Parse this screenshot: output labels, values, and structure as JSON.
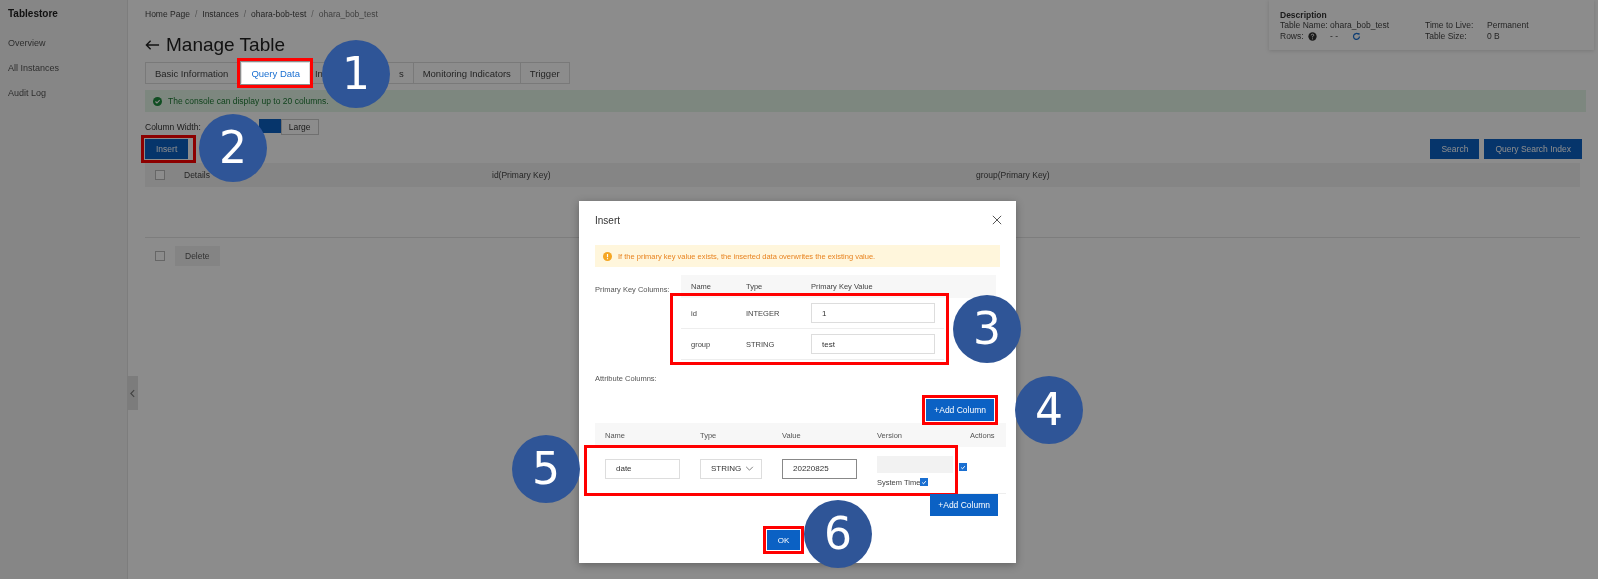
{
  "sidebar": {
    "title": "Tablestore",
    "items": [
      {
        "label": "Overview"
      },
      {
        "label": "All Instances"
      },
      {
        "label": "Audit Log"
      }
    ]
  },
  "breadcrumb": {
    "separator": "/",
    "items": [
      "Home Page",
      "Instances",
      "ohara-bob-test",
      "ohara_bob_test"
    ]
  },
  "page_title": "Manage Table",
  "tabs": [
    {
      "label": "Basic Information",
      "selected": false
    },
    {
      "label": "Query Data",
      "selected": true,
      "highlighted": true
    },
    {
      "label_parts": [
        "In",
        "s"
      ],
      "selected": false
    },
    {
      "label": "Monitoring Indicators",
      "selected": false
    },
    {
      "label": "Trigger",
      "selected": false
    }
  ],
  "notice": {
    "text": "The console can display up to 20 columns."
  },
  "column_width": {
    "label": "Column Width:",
    "options": [
      {
        "selected": true
      },
      {
        "label": "Large",
        "selected": false
      }
    ]
  },
  "toolbar": {
    "insert": {
      "label": "Insert",
      "highlighted": true
    },
    "search": "Search",
    "query_search_index": "Query Search Index"
  },
  "table": {
    "select_all_checked": false,
    "columns": [
      "Details",
      "id(Primary Key)",
      "group(Primary Key)"
    ],
    "footer": {
      "checked": false,
      "delete": {
        "label": "Delete",
        "disabled": true
      }
    }
  },
  "description": {
    "title": "Description",
    "table_name": {
      "label": "Table Name:",
      "value": "ohara_bob_test"
    },
    "rows": {
      "label": "Rows:",
      "value": "- -"
    },
    "ttl": {
      "label": "Time to Live:",
      "value": "Permanent"
    },
    "size": {
      "label": "Table Size:",
      "value": "0 B"
    }
  },
  "dialog": {
    "title": "Insert",
    "warning": "If the primary key value exists, the inserted data overwrites the existing value.",
    "primary_key": {
      "label": "Primary Key Columns:",
      "columns": [
        "Name",
        "Type",
        "Primary Key Value"
      ],
      "highlighted": true,
      "rows": [
        {
          "name": "id",
          "type": "INTEGER",
          "value": "1"
        },
        {
          "name": "group",
          "type": "STRING",
          "value": "test"
        }
      ]
    },
    "attribute": {
      "label": "Attribute Columns:",
      "add_button": {
        "label": "+Add Column",
        "highlighted": true
      },
      "columns": [
        "Name",
        "Type",
        "Value",
        "Version",
        "Actions"
      ],
      "rows": [
        {
          "name": "date",
          "type": "STRING",
          "value": "20220825",
          "version_label": "System Time",
          "system_time_checked": true,
          "action_checked": true,
          "highlighted": true
        }
      ],
      "add_button_bottom": {
        "label": "+Add Column",
        "highlighted": false
      }
    },
    "ok": {
      "label": "OK",
      "highlighted": true
    }
  },
  "callouts": [
    "1",
    "2",
    "3",
    "4",
    "5",
    "6"
  ]
}
